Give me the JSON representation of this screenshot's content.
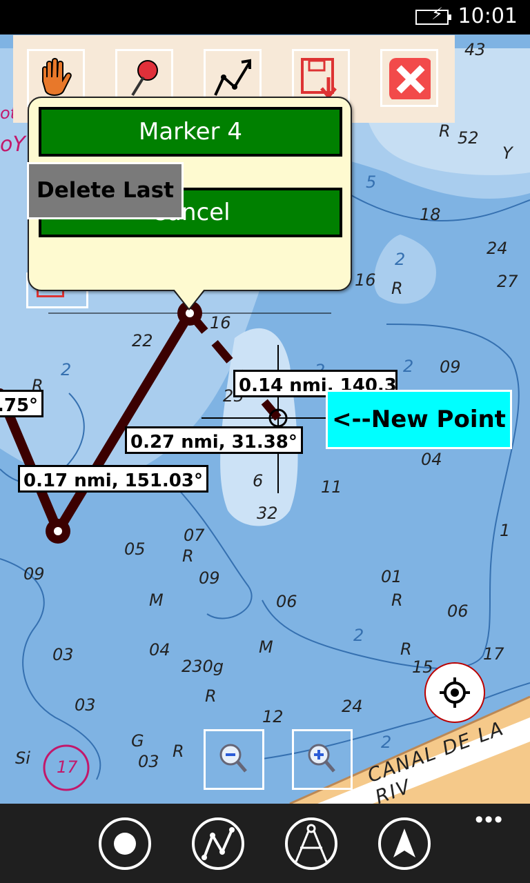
{
  "status_bar": {
    "time": "10:01",
    "battery_icon": "battery-charging-icon"
  },
  "toolbar": {
    "buttons": [
      {
        "name": "pan",
        "icon": "hand-icon"
      },
      {
        "name": "marker",
        "icon": "pushpin-icon"
      },
      {
        "name": "route",
        "icon": "route-line-icon"
      },
      {
        "name": "save",
        "icon": "save-export-icon"
      },
      {
        "name": "close",
        "icon": "close-icon"
      }
    ]
  },
  "popup": {
    "marker_label": "Marker 4",
    "cancel_label": "Cancel",
    "delete_last_label": "Delete Last"
  },
  "measurements": {
    "left_partial": ".75°",
    "seg1": "0.17 nmi, 151.03°",
    "seg2": "0.27 nmi, 31.38°",
    "seg3": "0.14 nmi, 140.37°"
  },
  "new_point_label": "<--New Point",
  "chart_labels": {
    "depths": [
      "43",
      "R",
      "52",
      "Y",
      "5",
      "18",
      "24",
      "27",
      "2",
      "16",
      "R",
      "22",
      "16",
      "2",
      "09",
      "25",
      "2",
      "R",
      "2",
      "04",
      "6",
      "11",
      "32",
      "05",
      "07",
      "R",
      "09",
      "09",
      "01",
      "R",
      "06",
      "M",
      "06",
      "03",
      "04",
      "M",
      "2",
      "230g",
      "R",
      "R",
      "15",
      "17",
      "03",
      "12",
      "24",
      "G",
      "R",
      "03",
      "Si",
      "17",
      "1",
      "2",
      "oY",
      "ot"
    ],
    "canal_text": "CANAL DE LA RIV"
  },
  "map_controls": {
    "zoom_out_icon": "zoom-out-icon",
    "zoom_in_icon": "zoom-in-icon",
    "locate_icon": "locate-target-icon"
  },
  "app_bar": {
    "buttons": [
      {
        "name": "record",
        "icon": "record-icon"
      },
      {
        "name": "routes",
        "icon": "routes-icon"
      },
      {
        "name": "measure",
        "icon": "compass-divider-icon"
      },
      {
        "name": "navigate",
        "icon": "navigation-arrow-icon"
      }
    ],
    "more_label": "•••"
  },
  "colors": {
    "toolbar_bg": "#f7e9d8",
    "popup_bg": "#fefad0",
    "button_green": "#008000",
    "new_point_bg": "#00ffff",
    "route_line": "#3b0000",
    "app_bar_bg": "#1f1f1f"
  }
}
